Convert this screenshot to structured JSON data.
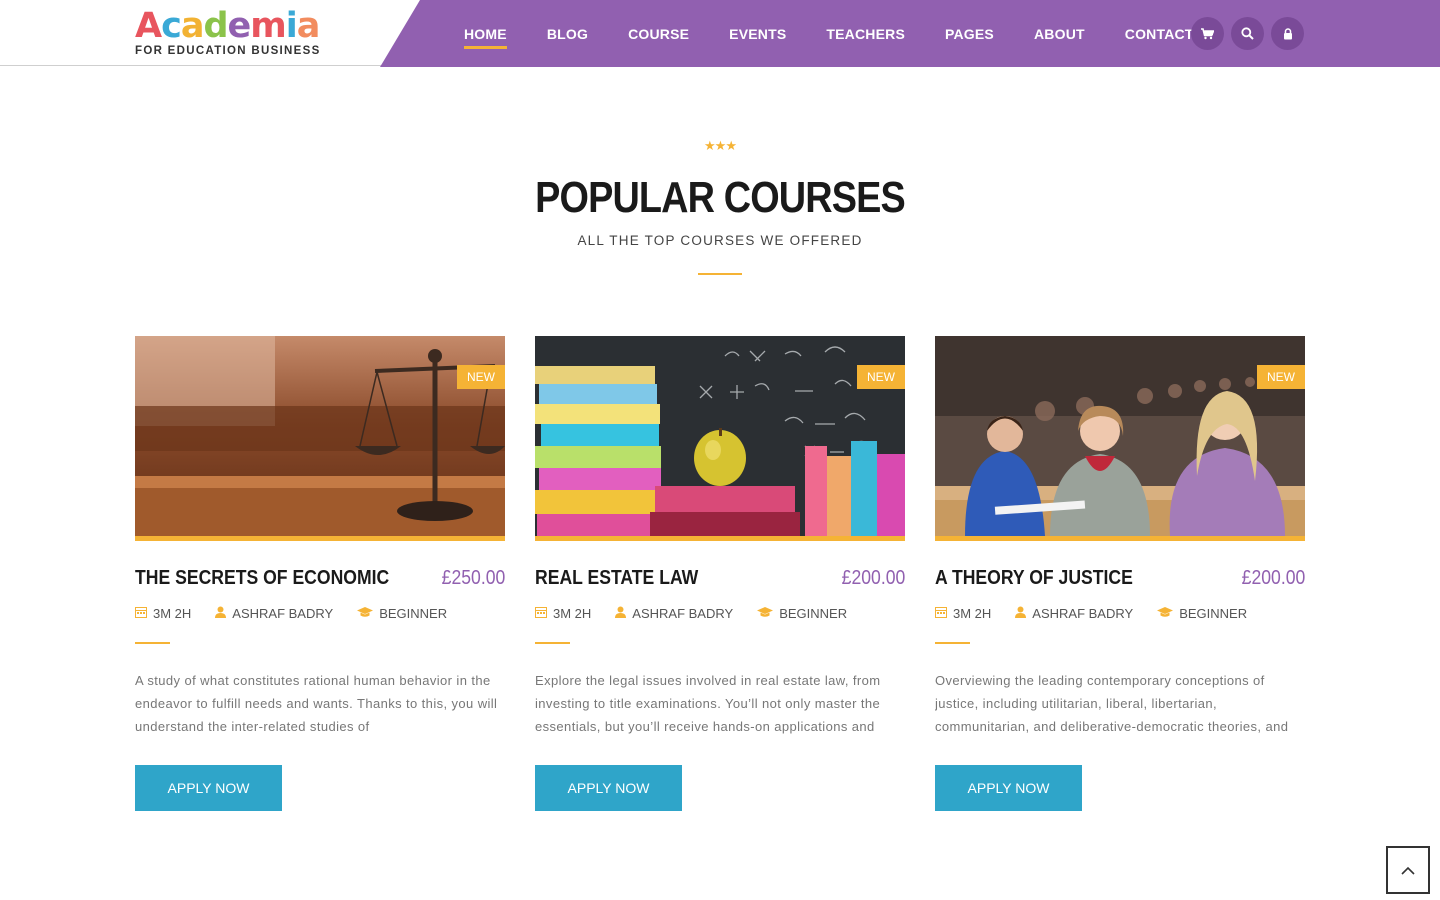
{
  "brand": {
    "logo_letters": [
      "A",
      "c",
      "a",
      "d",
      "e",
      "m",
      "i",
      "a"
    ],
    "tagline": "FOR EDUCATION BUSINESS",
    "colors": {
      "purple": "#9160b0",
      "accent": "#f5b335",
      "button": "#2fa5c9"
    }
  },
  "nav": {
    "items": [
      "HOME",
      "BLOG",
      "COURSE",
      "EVENTS",
      "TEACHERS",
      "PAGES",
      "ABOUT",
      "CONTACT"
    ],
    "active": "HOME"
  },
  "header_icons": [
    "cart-icon",
    "search-icon",
    "lock-icon"
  ],
  "section": {
    "stars": "★★★",
    "title": "POPULAR COURSES",
    "subtitle": "ALL THE TOP COURSES WE OFFERED"
  },
  "courses": [
    {
      "badge": "NEW",
      "title": "THE SECRETS OF ECONOMIC",
      "price": "£250.00",
      "duration": "3M 2H",
      "instructor": "ASHRAF BADRY",
      "level": "BEGINNER",
      "description": "A study of what constitutes rational human behavior in the endeavor to fulfill needs and wants. Thanks to this, you will understand the inter-related studies of",
      "button": "APPLY NOW",
      "image": "justice-scales-courtroom"
    },
    {
      "badge": "NEW",
      "title": "REAL ESTATE LAW",
      "price": "£200.00",
      "duration": "3M 2H",
      "instructor": "ASHRAF BADRY",
      "level": "BEGINNER",
      "description": "Explore the legal issues involved in real estate law, from investing to title examinations. You’ll not only master the essentials, but you’ll receive hands-on applications and",
      "button": "APPLY NOW",
      "image": "books-apple-chalkboard"
    },
    {
      "badge": "NEW",
      "title": "A THEORY OF JUSTICE",
      "price": "£200.00",
      "duration": "3M 2H",
      "instructor": "ASHRAF BADRY",
      "level": "BEGINNER",
      "description": "Overviewing the leading contemporary conceptions of justice, including utilitarian, liberal, libertarian, communitarian, and deliberative-democratic theories, and",
      "button": "APPLY NOW",
      "image": "students-lecture-hall"
    }
  ],
  "scroll_top_icon": "chevron-up-icon"
}
